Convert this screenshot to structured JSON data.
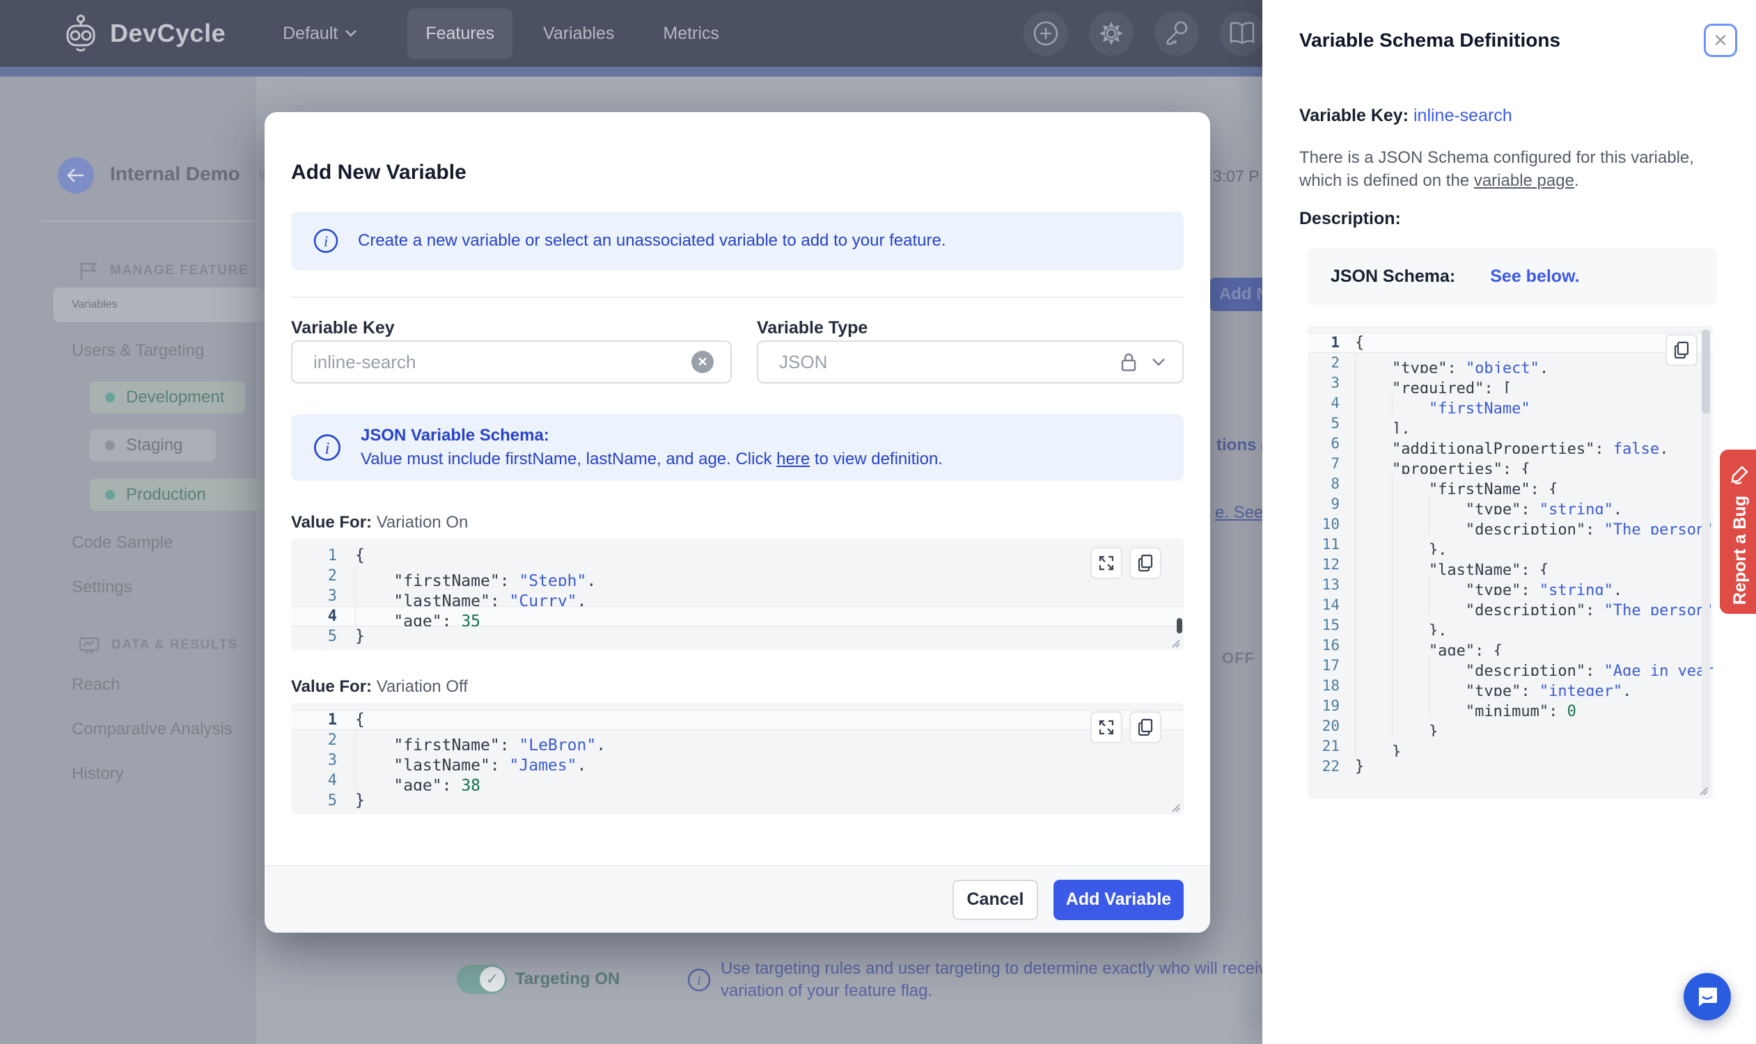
{
  "navbar": {
    "brand": "DevCycle",
    "project": "Default",
    "tabs": [
      {
        "label": "Features",
        "active": true
      },
      {
        "label": "Variables",
        "active": false
      },
      {
        "label": "Metrics",
        "active": false
      }
    ]
  },
  "background": {
    "feature_title": "Internal Demo",
    "feature_key_fragment": "in",
    "timestamp_fragment": "3:07 P",
    "add_button_fragment": "Add Ne",
    "row_fragment_1": "tions ar",
    "row_fragment_2": "e. See C",
    "row_fragment_3": "OFF",
    "targeting_label": "Targeting ON",
    "targeting_info_line1": "Use targeting rules and user targeting to determine exactly who will receiv",
    "targeting_info_line2": "variation of your feature flag."
  },
  "sidebar": {
    "section1": "MANAGE FEATURE",
    "items1": [
      "Variables",
      "Users & Targeting"
    ],
    "environments": [
      "Development",
      "Staging",
      "Production"
    ],
    "items2": [
      "Code Sample",
      "Settings"
    ],
    "section2": "DATA & RESULTS",
    "items3": [
      "Reach",
      "Comparative Analysis",
      "History"
    ]
  },
  "modal": {
    "title": "Add New Variable",
    "alert1": "Create a new variable or select an unassociated variable to add to your feature.",
    "variable_key": {
      "label": "Variable Key",
      "value": "inline-search"
    },
    "variable_type": {
      "label": "Variable Type",
      "value": "JSON"
    },
    "schema_alert": {
      "heading": "JSON Variable Schema:",
      "line2_pre": "Value must include firstName, lastName, and age. Click ",
      "link": "here",
      "line2_post": " to view definition."
    },
    "value_on_label_bold": "Value For: ",
    "value_on_label": "Variation On",
    "value_off_label_bold": "Value For: ",
    "value_off_label": "Variation Off",
    "cancel_label": "Cancel",
    "add_label": "Add Variable",
    "value_on": {
      "active_line": 4,
      "lines": [
        {
          "ind": 0,
          "seg": [
            [
              "p",
              "{"
            ]
          ]
        },
        {
          "ind": 1,
          "seg": [
            [
              "p",
              "\"firstName\": "
            ],
            [
              "s",
              "\"Steph\""
            ],
            [
              "p",
              ","
            ]
          ]
        },
        {
          "ind": 1,
          "seg": [
            [
              "p",
              "\"lastName\": "
            ],
            [
              "s",
              "\"Curry\""
            ],
            [
              "p",
              ","
            ]
          ]
        },
        {
          "ind": 1,
          "seg": [
            [
              "p",
              "\"age\": "
            ],
            [
              "n",
              "35"
            ]
          ]
        },
        {
          "ind": 0,
          "seg": [
            [
              "p",
              "}"
            ]
          ]
        }
      ]
    },
    "value_off": {
      "active_line": 1,
      "lines": [
        {
          "ind": 0,
          "seg": [
            [
              "p",
              "{"
            ]
          ]
        },
        {
          "ind": 1,
          "seg": [
            [
              "p",
              "\"firstName\": "
            ],
            [
              "s",
              "\"LeBron\""
            ],
            [
              "p",
              ","
            ]
          ]
        },
        {
          "ind": 1,
          "seg": [
            [
              "p",
              "\"lastName\": "
            ],
            [
              "s",
              "\"James\""
            ],
            [
              "p",
              ","
            ]
          ]
        },
        {
          "ind": 1,
          "seg": [
            [
              "p",
              "\"age\": "
            ],
            [
              "n",
              "38"
            ]
          ]
        },
        {
          "ind": 0,
          "seg": [
            [
              "p",
              "}"
            ]
          ]
        }
      ]
    }
  },
  "panel": {
    "title": "Variable Schema Definitions",
    "varkey_label": "Variable Key: ",
    "varkey_value": "inline-search",
    "para_line1": "There is a JSON Schema configured for this variable,",
    "para_line2_pre": "which is defined on the ",
    "para_link": "variable page",
    "para_line2_post": ".",
    "description_label": "Description:",
    "schema_card_label": "JSON Schema:",
    "schema_card_link": "See below.",
    "report_bug_label": "Report a Bug",
    "schema_code": {
      "active_line": 1,
      "lines": [
        {
          "ind": 0,
          "seg": [
            [
              "p",
              "{"
            ]
          ]
        },
        {
          "ind": 1,
          "seg": [
            [
              "p",
              "\"type\": "
            ],
            [
              "s",
              "\"object\""
            ],
            [
              "p",
              ","
            ]
          ]
        },
        {
          "ind": 1,
          "seg": [
            [
              "p",
              "\"required\": ["
            ]
          ]
        },
        {
          "ind": 2,
          "seg": [
            [
              "s",
              "\"firstName\""
            ]
          ]
        },
        {
          "ind": 1,
          "seg": [
            [
              "p",
              "],"
            ]
          ]
        },
        {
          "ind": 1,
          "seg": [
            [
              "p",
              "\"additionalProperties\": "
            ],
            [
              "s",
              "false"
            ],
            [
              "p",
              ","
            ]
          ]
        },
        {
          "ind": 1,
          "seg": [
            [
              "p",
              "\"properties\": {"
            ]
          ]
        },
        {
          "ind": 2,
          "seg": [
            [
              "p",
              "\"firstName\": {"
            ]
          ]
        },
        {
          "ind": 3,
          "seg": [
            [
              "p",
              "\"type\": "
            ],
            [
              "s",
              "\"string\""
            ],
            [
              "p",
              ","
            ]
          ]
        },
        {
          "ind": 3,
          "seg": [
            [
              "p",
              "\"description\": "
            ],
            [
              "s",
              "\"The person's fi"
            ]
          ]
        },
        {
          "ind": 2,
          "seg": [
            [
              "p",
              "},"
            ]
          ]
        },
        {
          "ind": 2,
          "seg": [
            [
              "p",
              "\"lastName\": {"
            ]
          ]
        },
        {
          "ind": 3,
          "seg": [
            [
              "p",
              "\"type\": "
            ],
            [
              "s",
              "\"string\""
            ],
            [
              "p",
              ","
            ]
          ]
        },
        {
          "ind": 3,
          "seg": [
            [
              "p",
              "\"description\": "
            ],
            [
              "s",
              "\"The person's la"
            ]
          ]
        },
        {
          "ind": 2,
          "seg": [
            [
              "p",
              "},"
            ]
          ]
        },
        {
          "ind": 2,
          "seg": [
            [
              "p",
              "\"age\": {"
            ]
          ]
        },
        {
          "ind": 3,
          "seg": [
            [
              "p",
              "\"description\": "
            ],
            [
              "s",
              "\"Age in years wh"
            ]
          ]
        },
        {
          "ind": 3,
          "seg": [
            [
              "p",
              "\"type\": "
            ],
            [
              "s",
              "\"integer\""
            ],
            [
              "p",
              ","
            ]
          ]
        },
        {
          "ind": 3,
          "seg": [
            [
              "p",
              "\"minimum\": "
            ],
            [
              "n",
              "0"
            ]
          ]
        },
        {
          "ind": 2,
          "seg": [
            [
              "p",
              "}"
            ]
          ]
        },
        {
          "ind": 1,
          "seg": [
            [
              "p",
              "}"
            ]
          ]
        },
        {
          "ind": 0,
          "seg": [
            [
              "p",
              "}"
            ]
          ]
        }
      ]
    }
  },
  "colors": {
    "accent": "#3c5ae8",
    "info_blue": "#2742c8",
    "code_string": "#3b5bd3",
    "code_number": "#15714e",
    "bug_red": "#df4b45"
  }
}
